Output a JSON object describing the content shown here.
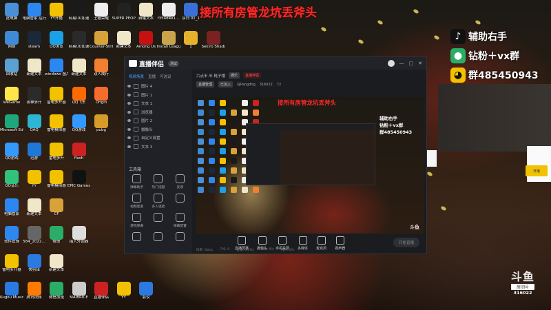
{
  "banner": {
    "text": "接所有房管龙坑丢斧头"
  },
  "desktop_icons": [
    {
      "label": "此电脑",
      "color": "#4a90d9",
      "col": 0,
      "row": 0
    },
    {
      "label": "电脑管家 运行检测",
      "color": "#2d87f0",
      "col": 1,
      "row": 0
    },
    {
      "label": "YY开播",
      "color": "#f2c200",
      "col": 2,
      "row": 0
    },
    {
      "label": "网易UU加速",
      "color": "#1a1a1a",
      "col": 3,
      "row": 0
    },
    {
      "label": "王者荣耀",
      "color": "#eee",
      "col": 4,
      "row": 0
    },
    {
      "label": "SUPER PEOPLE CBT",
      "color": "#222",
      "col": 5,
      "row": 0
    },
    {
      "label": "新建文本",
      "color": "#f0e6c8",
      "col": 6,
      "row": 0
    },
    {
      "label": "f354d4e1...",
      "color": "#eee",
      "col": 7,
      "row": 0
    },
    {
      "label": "序列 01_1",
      "color": "#3b6fd8",
      "col": 8,
      "row": 0
    },
    {
      "label": "网络",
      "color": "#3e8ad6",
      "col": 0,
      "row": 1
    },
    {
      "label": "steam",
      "color": "#1b2838",
      "col": 1,
      "row": 1
    },
    {
      "label": "QQ浏览",
      "color": "#1aa1e8",
      "col": 2,
      "row": 1
    },
    {
      "label": "网易UU加速",
      "color": "#2a2a2a",
      "col": 3,
      "row": 1
    },
    {
      "label": "Counter-Strike Global Off...",
      "color": "#d8a23a",
      "col": 4,
      "row": 1
    },
    {
      "label": "新建文本",
      "color": "#f0e6c8",
      "col": 5,
      "row": 1
    },
    {
      "label": "Among Us",
      "color": "#c51111",
      "col": 6,
      "row": 1
    },
    {
      "label": "Install League o...",
      "color": "#caa44a",
      "col": 7,
      "row": 1
    },
    {
      "label": "1",
      "color": "#e7b22b",
      "col": 8,
      "row": 1
    },
    {
      "label": "Sekiro Shadow...",
      "color": "#7a2222",
      "col": 9,
      "row": 1
    },
    {
      "label": "回收站",
      "color": "#5aa0d0",
      "col": 0,
      "row": 2
    },
    {
      "label": "新建文本",
      "color": "#f0e6c8",
      "col": 1,
      "row": 2
    },
    {
      "label": "windows 图片查看",
      "color": "#2d87f0",
      "col": 2,
      "row": 2
    },
    {
      "label": "新建文本",
      "color": "#f0e6c8",
      "col": 3,
      "row": 2
    },
    {
      "label": "双人成行",
      "color": "#f08030",
      "col": 4,
      "row": 2
    },
    {
      "label": "WeGame",
      "color": "#ffe64a",
      "col": 0,
      "row": 3
    },
    {
      "label": "夜神多开",
      "color": "#2b2b2b",
      "col": 1,
      "row": 3
    },
    {
      "label": "雷电多开器",
      "color": "#f2c200",
      "col": 2,
      "row": 3
    },
    {
      "label": "QQ飞车",
      "color": "#ff6a00",
      "col": 3,
      "row": 3
    },
    {
      "label": "Origin",
      "color": "#f56c2d",
      "col": 4,
      "row": 3
    },
    {
      "label": "Microsoft Edge",
      "color": "#1fa67a",
      "col": 0,
      "row": 4
    },
    {
      "label": "QAQ",
      "color": "#2db5d4",
      "col": 1,
      "row": 4
    },
    {
      "label": "雷电模拟器",
      "color": "#f2c200",
      "col": 2,
      "row": 4
    },
    {
      "label": "QQ游戏",
      "color": "#3399ff",
      "col": 3,
      "row": 4
    },
    {
      "label": "pubg",
      "color": "#d79b2a",
      "col": 4,
      "row": 4
    },
    {
      "label": "QQ游戏",
      "color": "#3399ff",
      "col": 0,
      "row": 5
    },
    {
      "label": "迅游",
      "color": "#1e78d8",
      "col": 1,
      "row": 5
    },
    {
      "label": "雷电多开",
      "color": "#f2c200",
      "col": 2,
      "row": 5
    },
    {
      "label": "flash",
      "color": "#c22",
      "col": 3,
      "row": 5
    },
    {
      "label": "QQ音乐",
      "color": "#31c27c",
      "col": 0,
      "row": 6
    },
    {
      "label": "YY",
      "color": "#f2c200",
      "col": 1,
      "row": 6
    },
    {
      "label": "雷电模拟器",
      "color": "#f2c200",
      "col": 2,
      "row": 6
    },
    {
      "label": "EPIC Games",
      "color": "#111",
      "col": 3,
      "row": 6
    },
    {
      "label": "电脑管家",
      "color": "#2d87f0",
      "col": 0,
      "row": 7
    },
    {
      "label": "新建文本",
      "color": "#f0e6c8",
      "col": 1,
      "row": 7
    },
    {
      "label": "CF",
      "color": "#d8a23a",
      "col": 2,
      "row": 7
    },
    {
      "label": "软件管理",
      "color": "#2d87f0",
      "col": 0,
      "row": 8
    },
    {
      "label": "584_2022...",
      "color": "#666",
      "col": 1,
      "row": 8
    },
    {
      "label": "微信",
      "color": "#2aae67",
      "col": 2,
      "row": 8
    },
    {
      "label": "插入外调器",
      "color": "#ddd",
      "col": 3,
      "row": 8
    },
    {
      "label": "雷电多开器",
      "color": "#f2c200",
      "col": 0,
      "row": 9
    },
    {
      "label": "快剪辑",
      "color": "#2a7ae2",
      "col": 1,
      "row": 9
    },
    {
      "label": "新建文本",
      "color": "#f0e6c8",
      "col": 2,
      "row": 9
    },
    {
      "label": "Kugou Music",
      "color": "#2a7ae2",
      "col": 0,
      "row": 10
    },
    {
      "label": "腾讯视频",
      "color": "#ff7a00",
      "col": 1,
      "row": 10
    },
    {
      "label": "微信加速",
      "color": "#2aae67",
      "col": 2,
      "row": 10
    },
    {
      "label": "MAIBRICE",
      "color": "#ccc",
      "col": 3,
      "row": 10
    },
    {
      "label": "直播伴侣",
      "color": "#c22",
      "col": 4,
      "row": 10
    },
    {
      "label": "YY",
      "color": "#f2c200",
      "col": 5,
      "row": 10
    },
    {
      "label": "会议",
      "color": "#2a7ae2",
      "col": 6,
      "row": 10
    }
  ],
  "promo": {
    "row1": {
      "icon": "douyin-icon",
      "text": "辅助右手"
    },
    "row2": {
      "icon": "wechat-icon",
      "text": "钻粉＋vx群"
    },
    "row3": {
      "icon": "qq-icon",
      "text": "群485450943"
    }
  },
  "app": {
    "logo_text": "直播伴侣",
    "version_badge": "测试",
    "side_tabs": [
      "视频场景",
      "直播",
      "可选设"
    ],
    "scenes": [
      "图片 4",
      "图片 1",
      "文本 1",
      "浏览器",
      "图片 2",
      "摄像头",
      "自定义设置",
      "文本 3"
    ],
    "tools_heading": "工具箱",
    "tools": [
      "弹幕助手",
      "热门话题",
      "反馈",
      "视频连麦",
      "多人连麦",
      "",
      "游戏弹幕",
      "",
      "弹幕配置",
      "",
      "",
      ""
    ],
    "stream_title": "六点半·半 耗子哦",
    "pill_gray": "娱乐",
    "pill_red": "直播伴侣",
    "sub_info": [
      "直播管理",
      "已加入",
      "在Pangdng",
      "316022",
      "72"
    ],
    "preview_banner": "接所有房管龙坑丢斧头",
    "preview_promo": [
      "辅助右手",
      "钻粉＋vx群",
      "群485450943"
    ],
    "preview_tag": "斗鱼",
    "bottom_buttons": [
      "直播屏幕",
      "摄像头",
      "手机投屏",
      "多媒体",
      "麦克风",
      "扬声器"
    ],
    "start_button": "开始直播",
    "status": [
      "码率: 0kb/s",
      "FPS: 0",
      "丢帧: 0(0%)",
      "CPU: 0%",
      "内存: 0%"
    ]
  },
  "right": {
    "yellow_button": "开播"
  },
  "watermark": {
    "logo": "斗鱼",
    "site": "房间号",
    "room": "316022"
  }
}
